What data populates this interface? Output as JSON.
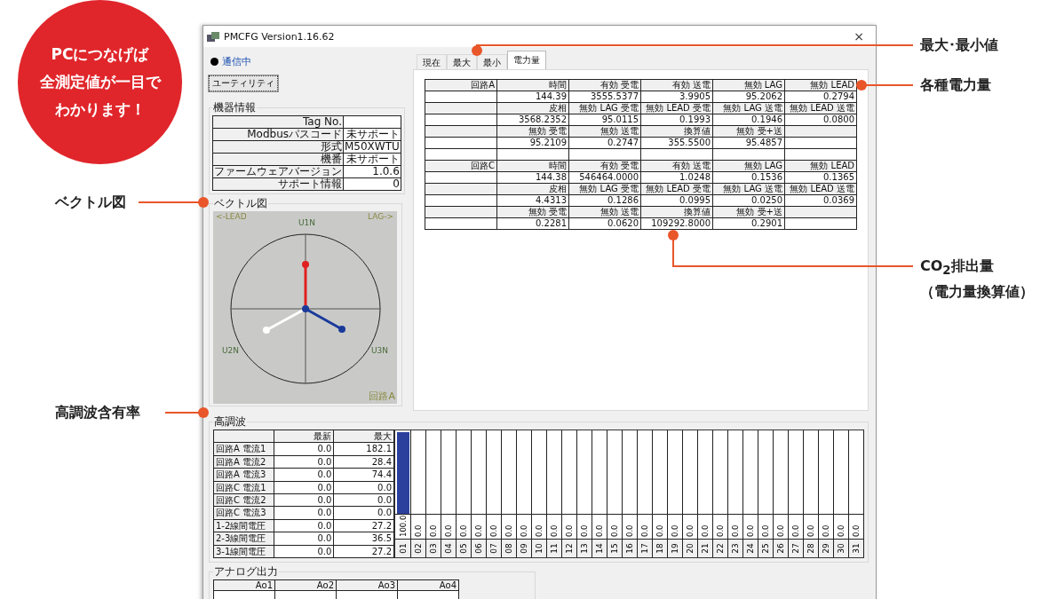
{
  "callouts": {
    "badge_lines": [
      "PCにつなげば",
      "全測定値が一目で",
      "わかります！"
    ],
    "vector_label": "ベクトル図",
    "harmonic_label": "高調波含有率",
    "minmax_label": "最大･最小値",
    "energy_label": "各種電力量",
    "co2_lines": [
      "CO$_{2}$排出量",
      "（電力量換算値）"
    ]
  },
  "window": {
    "title": "PMCFG Version1.16.62",
    "close": "×"
  },
  "status": {
    "text": "通信中"
  },
  "utility_button": "ユーティリティ",
  "device_info": {
    "title": "機器情報",
    "rows": [
      {
        "label": "Tag No."
      },
      {
        "label": "Modbusパスコード",
        "value": "未サポート"
      },
      {
        "label": "形式",
        "value": "M50XWTU"
      },
      {
        "label": "機番",
        "value": "未サポート"
      },
      {
        "label": "ファームウェアバージョン",
        "value": "1.0.6"
      },
      {
        "label": "サポート情報",
        "value": "0"
      }
    ]
  },
  "vector": {
    "title": "ベクトル図",
    "lead": "<-LEAD",
    "lag": "LAG->",
    "u1": "U1N",
    "u2": "U2N",
    "u3": "U3N",
    "circuit": "回路A"
  },
  "tabs": [
    {
      "label": "現在",
      "selected": false
    },
    {
      "label": "最大",
      "selected": false
    },
    {
      "label": "最小",
      "selected": false
    },
    {
      "label": "電力量",
      "selected": true
    }
  ],
  "energy": {
    "sections": [
      {
        "circuit": "回路A",
        "rows": [
          {
            "labels": [
              "時間",
              "有効 受電",
              "有効 送電",
              "無効 LAG",
              "無効 LEAD"
            ],
            "values": [
              "144.39",
              "3555.5377",
              "3.9905",
              "95.2062",
              "0.2794"
            ]
          },
          {
            "labels": [
              "皮相",
              "無効 LAG 受電",
              "無効 LEAD 受電",
              "無効 LAG 送電",
              "無効 LEAD 送電"
            ],
            "values": [
              "3568.2352",
              "95.0115",
              "0.1993",
              "0.1946",
              "0.0800"
            ]
          },
          {
            "labels": [
              "無効 受電",
              "無効 送電",
              "換算値",
              "無効 受+送"
            ],
            "values": [
              "95.2109",
              "0.2747",
              "355.5500",
              "95.4857"
            ]
          }
        ]
      },
      {
        "circuit": "回路C",
        "rows": [
          {
            "labels": [
              "時間",
              "有効 受電",
              "有効 送電",
              "無効 LAG",
              "無効 LEAD"
            ],
            "values": [
              "144.38",
              "546464.0000",
              "1.0248",
              "0.1536",
              "0.1365"
            ]
          },
          {
            "labels": [
              "皮相",
              "無効 LAG 受電",
              "無効 LEAD 受電",
              "無効 LAG 送電",
              "無効 LEAD 送電"
            ],
            "values": [
              "4.4313",
              "0.1286",
              "0.0995",
              "0.0250",
              "0.0369"
            ]
          },
          {
            "labels": [
              "無効 受電",
              "無効 送電",
              "換算値",
              "無効 受+送"
            ],
            "values": [
              "0.2281",
              "0.0620",
              "109292.8000",
              "0.2901"
            ]
          }
        ]
      }
    ]
  },
  "harmonics": {
    "title": "高調波",
    "columns": [
      "最新",
      "最大"
    ],
    "rows": [
      {
        "name": "回路A 電流1",
        "latest": "0.0",
        "max": "182.1"
      },
      {
        "name": "回路A 電流2",
        "latest": "0.0",
        "max": "28.4"
      },
      {
        "name": "回路A 電流3",
        "latest": "0.0",
        "max": "74.4"
      },
      {
        "name": "回路C 電流1",
        "latest": "0.0",
        "max": "0.0"
      },
      {
        "name": "回路C 電流2",
        "latest": "0.0",
        "max": "0.0"
      },
      {
        "name": "回路C 電流3",
        "latest": "0.0",
        "max": "0.0"
      },
      {
        "name": "1-2線間電圧",
        "latest": "0.0",
        "max": "27.2"
      },
      {
        "name": "2-3線間電圧",
        "latest": "0.0",
        "max": "36.5"
      },
      {
        "name": "3-1線間電圧",
        "latest": "0.0",
        "max": "27.2"
      }
    ],
    "chart_data": {
      "type": "bar",
      "categories": [
        "01",
        "02",
        "03",
        "04",
        "05",
        "06",
        "07",
        "08",
        "09",
        "10",
        "11",
        "12",
        "13",
        "14",
        "15",
        "16",
        "17",
        "18",
        "19",
        "20",
        "21",
        "22",
        "23",
        "24",
        "25",
        "26",
        "27",
        "28",
        "29",
        "30",
        "31"
      ],
      "values": [
        100.0,
        0,
        0,
        0,
        0,
        0,
        0,
        0,
        0,
        0,
        0,
        0,
        0,
        0,
        0,
        0,
        0,
        0,
        0,
        0,
        0,
        0,
        0,
        0,
        0,
        0,
        0,
        0,
        0,
        0,
        0
      ],
      "value_labels": [
        "100.0",
        "0.0",
        "0.0",
        "0.0",
        "0.0",
        "0.0",
        "0.0",
        "0.0",
        "0.0",
        "0.0",
        "0.0",
        "0.0",
        "0.0",
        "0.0",
        "0.0",
        "0.0",
        "0.0",
        "0.0",
        "0.0",
        "0.0",
        "0.0",
        "0.0",
        "0.0",
        "0.0",
        "0.0",
        "0.0",
        "0.0",
        "0.0",
        "0.0",
        "0.0",
        "0.0"
      ]
    }
  },
  "analog": {
    "title": "アナログ出力",
    "columns": [
      "Ao1",
      "Ao2",
      "Ao3",
      "Ao4"
    ]
  }
}
